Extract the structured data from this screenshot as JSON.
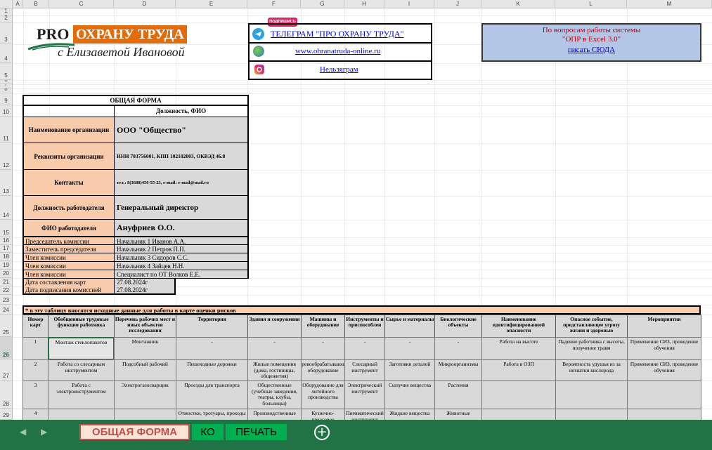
{
  "columns": [
    "A",
    "B",
    "C",
    "D",
    "E",
    "F",
    "G",
    "H",
    "I",
    "J",
    "K",
    "L",
    "M"
  ],
  "rows": [
    "1",
    "2",
    "3",
    "4",
    "5",
    "6",
    "7",
    "8",
    "9",
    "10",
    "11",
    "12",
    "13",
    "14",
    "15",
    "16",
    "17",
    "18",
    "19",
    "20",
    "21",
    "22",
    "23",
    "24",
    "25",
    "26",
    "27",
    "28",
    "29"
  ],
  "logo": {
    "pro": "PRO",
    "brand": "ОХРАНУ ТРУДА",
    "byline": "с Елизаветой Ивановой"
  },
  "links": {
    "badge": "ПОДПИШИСЬ",
    "telegram": "ТЕЛЕГРАМ \"ПРО ОХРАНУ ТРУДА\"",
    "website": "www.ohranatruda-online.ru",
    "instagram": "Нельзяграм"
  },
  "support": {
    "line1": "По вопросам работы системы",
    "line2": "\"ОПР в Excel 3.0\"",
    "link": "писать СЮДА"
  },
  "form": {
    "title": "ОБЩАЯ ФОРМА",
    "subheader": "Должность, ФИО",
    "org_label": "Наименование организации",
    "org_value": "ООО \"Общество\"",
    "req_label": "Реквизиты организации",
    "req_value": "ИНН 703756001, КПП 102102003, ОКВЭД 46.8",
    "contacts_label": "Контакты",
    "contacts_value": "тел.: 8(3688)456-55-23, e-mail: e-mail@mail.ru",
    "pos_label": "Должность работодателя",
    "pos_value": "Генеральный директор",
    "fio_label": "ФИО работодателя",
    "fio_value": "Ануфриев О.О.",
    "commission": [
      {
        "role": "Председатель комиссии",
        "person": "Начальник 1 Иванов А.А."
      },
      {
        "role": "Заместитель председателя",
        "person": "Начальник 2 Петров П.П."
      },
      {
        "role": "Член комиссии",
        "person": "Начальник 3 Сидоров С.С."
      },
      {
        "role": "Член комиссии",
        "person": "Начальник 4 Зайцев Н.Н."
      },
      {
        "role": "Член комиссии",
        "person": "Специалист по ОТ Волков Е.Е."
      }
    ],
    "date_cards_label": "Дата составления карт",
    "date_cards": "27.08.2024г",
    "date_sign_label": "Дата подписания комиссией",
    "date_sign": "27.08.2024г"
  },
  "table": {
    "note": "* в эту таблицу вносятся исходные данные для работы в карте оценки рисков",
    "headers": [
      "Номер карт",
      "Обобщенные трудовые функции работника",
      "Перечень рабочих мест и иных объектов исследования",
      "Территория",
      "Здания и сооружения",
      "Машины и оборудование",
      "Инструменты и приспособлен",
      "Сырье и материалы",
      "Биологические объекты",
      "Наименование идентифицированной опасности",
      "Опасное событие, представляющее угрозу жизни и здоровью",
      "Мероприятия"
    ],
    "rows": [
      [
        "1",
        "Монтаж стеклопакетов",
        "Монтажник",
        "-",
        "-",
        "-",
        "-",
        "-",
        "-",
        "Работа на высоте",
        "Падение работника с высоты, получение травм",
        "Применение СИЗ, проведение обучения"
      ],
      [
        "2",
        "Работа со слесарным инструментом",
        "Подсобный рабочий",
        "Пешеходные дорожки",
        "Жилые помещения (дома, гостиницы, общежития)",
        "Деревообрабатывающее оборудование",
        "Слесарный инструмент",
        "Заготовки деталей",
        "Микроорганизмы",
        "Работа в ОЗП",
        "Вероятность удушья из за нехватки кислорода",
        "Применение СИЗ, проведение обучения"
      ],
      [
        "3",
        "Работа с электроинструментом",
        "Электрогазосварщик",
        "Проезды для транспорта",
        "Общественные (учебные заведения, театры, клубы, больницы)",
        "Оборудование для литейного производства",
        "Электрический инструмент",
        "Сыпучие вещества",
        "Растения",
        "",
        "",
        ""
      ],
      [
        "4",
        "",
        "",
        "Отмостки, тротуары, проходы",
        "Производственные",
        "Кузнечно-прессовое",
        "Пневматический инструмент",
        "Жидкие вещества",
        "Животные",
        "",
        "",
        ""
      ]
    ]
  },
  "sheet_tabs": {
    "form": "ОБЩАЯ ФОРМА",
    "ko": "КО",
    "print": "ПЕЧАТЬ",
    "add": "+"
  },
  "colors": {
    "label_fill": "#f8cbad",
    "value_fill": "#d9d9d9",
    "tab_bar": "#217346",
    "logo_orange": "#e36c0a",
    "support_fill": "#b4c6e7"
  }
}
